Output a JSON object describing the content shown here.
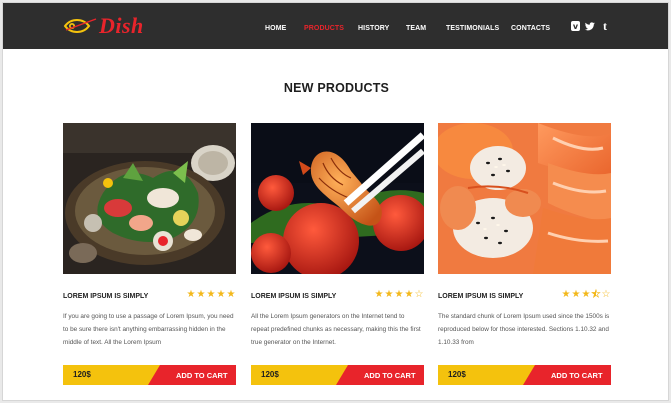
{
  "header": {
    "logo_text": "Dish",
    "nav": [
      {
        "label": "HOME",
        "active": false
      },
      {
        "label": "PRODUCTS",
        "active": true
      },
      {
        "label": "HISTORY",
        "active": false
      },
      {
        "label": "TEAM",
        "active": false
      },
      {
        "label": "TESTIMONIALS",
        "active": false
      },
      {
        "label": "CONTACTS",
        "active": false
      }
    ],
    "social_icons": [
      "vimeo-icon",
      "twitter-icon",
      "tumblr-icon"
    ],
    "active_color": "#e8242b"
  },
  "main": {
    "section_title": "NEW PRODUCTS",
    "products": [
      {
        "title": "LOREM IPSUM IS SIMPLY",
        "rating": 5,
        "rating_max": 5,
        "description": "If you are going to use a passage of Lorem Ipsum, you need to be sure there isn't anything embarrassing hidden in the middle of text. All the Lorem Ipsum",
        "price": "120$",
        "cart_label": "ADD TO CART",
        "image": "sashimi-platter-photo"
      },
      {
        "title": "LOREM IPSUM IS SIMPLY",
        "rating": 4,
        "rating_max": 5,
        "description": "All the Lorem Ipsum generators on the Internet tend to repeat predefined chunks as necessary, making this the first true generator on the Internet.",
        "price": "120$",
        "cart_label": "ADD TO CART",
        "image": "shrimp-chopsticks-photo"
      },
      {
        "title": "LOREM IPSUM IS SIMPLY",
        "rating": 3.5,
        "rating_max": 5,
        "description": "The standard chunk of Lorem Ipsum used since the 1500s is reproduced below for those interested. Sections 1.10.32 and 1.10.33 from",
        "price": "120$",
        "cart_label": "ADD TO CART",
        "image": "salmon-rolls-photo"
      }
    ]
  },
  "colors": {
    "header_bg": "#2e2e2e",
    "price_bar": "#f4c20d",
    "cart_button": "#e8242b",
    "star": "#f3b81b"
  }
}
